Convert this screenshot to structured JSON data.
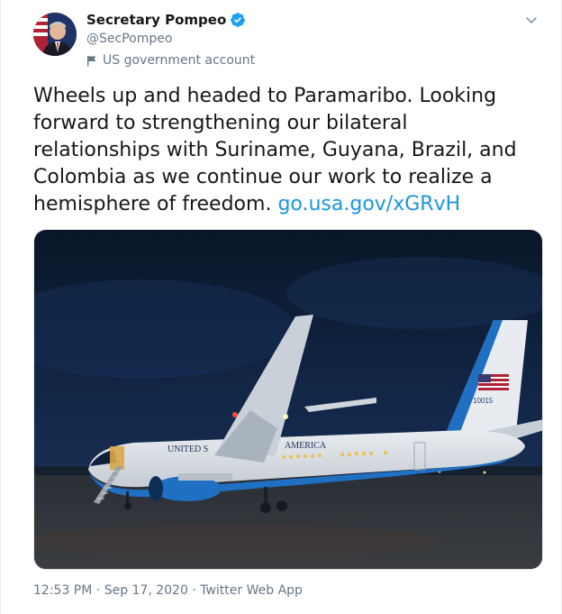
{
  "account": {
    "display_name": "Secretary Pompeo",
    "handle": "@SecPompeo",
    "label": "US government account",
    "verified": true
  },
  "tweet": {
    "text": "Wheels up and headed to Paramaribo. Looking forward to strengthening our bilateral relationships with Suriname, Guyana, Brazil, and Colombia as we continue our work to realize a hemisphere of freedom.",
    "link": "go.usa.gov/xGRvH"
  },
  "media": {
    "fuselage_left": "UNITED S",
    "fuselage_right": "AMERICA",
    "tail_number": "10015"
  },
  "meta": {
    "time": "12:53 PM",
    "separator": "·",
    "date": "Sep 17, 2020",
    "source": "Twitter Web App"
  },
  "colors": {
    "link": "#1b95e0",
    "verified": "#1da1f2",
    "muted": "#657786"
  },
  "icons": [
    "verified-badge-icon",
    "flag-icon",
    "chevron-down-icon"
  ]
}
